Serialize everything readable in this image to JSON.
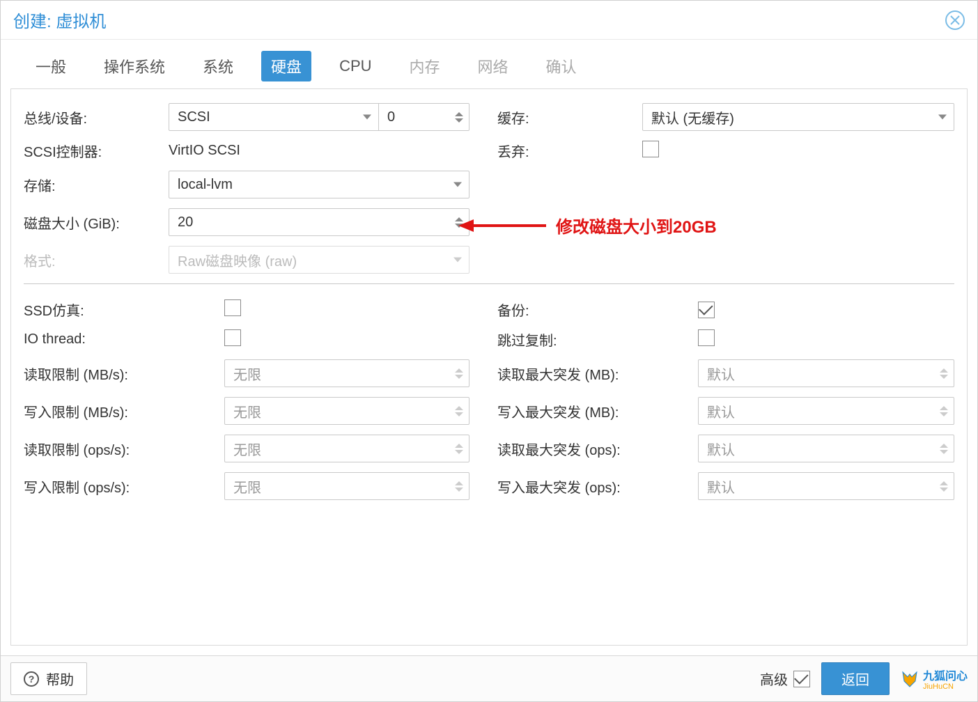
{
  "dialog": {
    "title": "创建: 虚拟机"
  },
  "tabs": [
    {
      "label": "一般",
      "state": "normal"
    },
    {
      "label": "操作系统",
      "state": "normal"
    },
    {
      "label": "系统",
      "state": "normal"
    },
    {
      "label": "硬盘",
      "state": "active"
    },
    {
      "label": "CPU",
      "state": "normal"
    },
    {
      "label": "内存",
      "state": "disabled"
    },
    {
      "label": "网络",
      "state": "disabled"
    },
    {
      "label": "确认",
      "state": "disabled"
    }
  ],
  "form": {
    "bus_label": "总线/设备:",
    "bus_value": "SCSI",
    "bus_index": "0",
    "scsi_ctrl_label": "SCSI控制器:",
    "scsi_ctrl_value": "VirtIO SCSI",
    "storage_label": "存储:",
    "storage_value": "local-lvm",
    "disk_size_label": "磁盘大小 (GiB):",
    "disk_size_value": "20",
    "format_label": "格式:",
    "format_value": "Raw磁盘映像 (raw)",
    "cache_label": "缓存:",
    "cache_value": "默认 (无缓存)",
    "discard_label": "丢弃:",
    "ssd_label": "SSD仿真:",
    "iothread_label": "IO thread:",
    "backup_label": "备份:",
    "backup_checked": true,
    "skiprep_label": "跳过复制:",
    "read_mbps_label": "读取限制 (MB/s):",
    "write_mbps_label": "写入限制 (MB/s):",
    "read_ops_label": "读取限制 (ops/s):",
    "write_ops_label": "写入限制 (ops/s):",
    "read_burst_mb_label": "读取最大突发 (MB):",
    "write_burst_mb_label": "写入最大突发 (MB):",
    "read_burst_ops_label": "读取最大突发 (ops):",
    "write_burst_ops_label": "写入最大突发 (ops):",
    "placeholder_unlimited": "无限",
    "placeholder_default": "默认"
  },
  "annotation": {
    "text": "修改磁盘大小到20GB"
  },
  "footer": {
    "help": "帮助",
    "advanced": "高级",
    "advanced_checked": true,
    "back": "返回",
    "watermark_cn": "九狐问心",
    "watermark_en": "JiuHuCN"
  }
}
